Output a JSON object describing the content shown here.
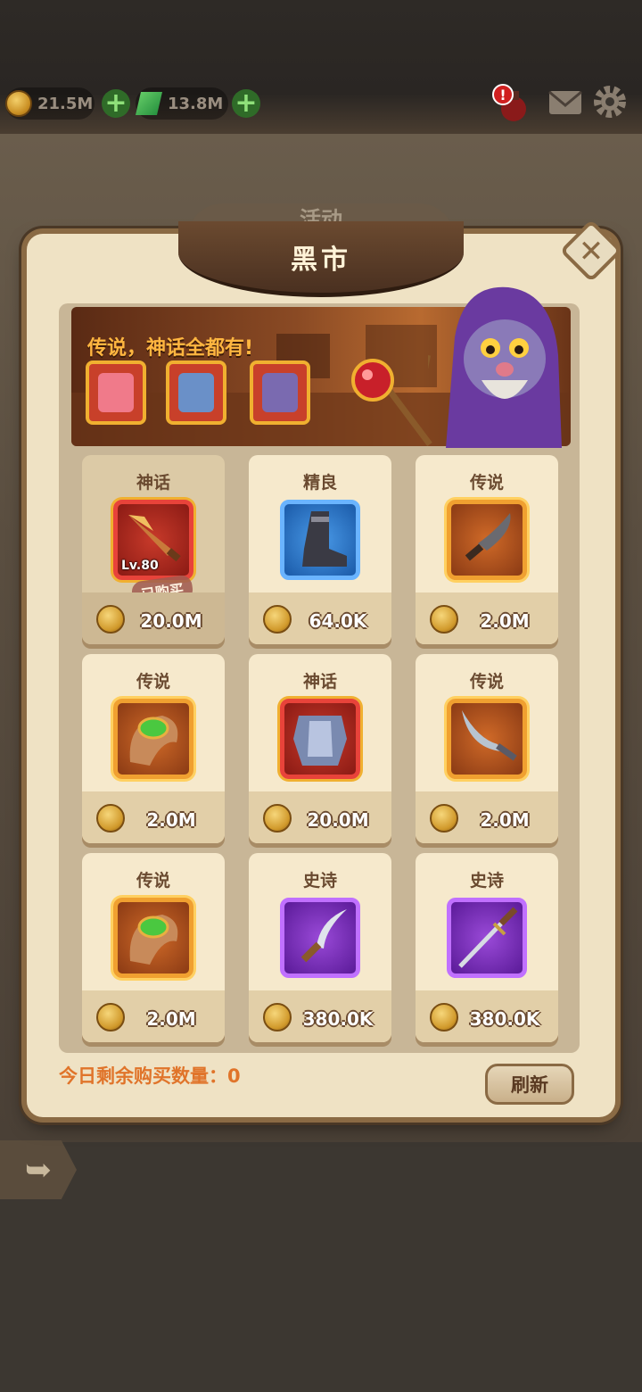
{
  "resources": {
    "gold": "21.5M",
    "gems": "13.8M"
  },
  "behind_title": "活动",
  "window": {
    "title": "黑市"
  },
  "banner": {
    "slogan": "传说，神话全都有!"
  },
  "items": [
    {
      "rarity": "神话",
      "price": "20.0M",
      "level": "Lv.80",
      "status": "已购买",
      "icon": "spear-tip-icon",
      "frame": "myth"
    },
    {
      "rarity": "精良",
      "price": "64.0K",
      "icon": "boot-icon",
      "frame": "good"
    },
    {
      "rarity": "传说",
      "price": "2.0M",
      "icon": "serrated-dagger-icon",
      "frame": "leg"
    },
    {
      "rarity": "传说",
      "price": "2.0M",
      "icon": "green-gem-horn-icon",
      "frame": "leg"
    },
    {
      "rarity": "神话",
      "price": "20.0M",
      "icon": "armor-icon",
      "frame": "myth"
    },
    {
      "rarity": "传说",
      "price": "2.0M",
      "icon": "curved-blade-icon",
      "frame": "leg"
    },
    {
      "rarity": "传说",
      "price": "2.0M",
      "icon": "green-gem-horn-icon",
      "frame": "leg"
    },
    {
      "rarity": "史诗",
      "price": "380.0K",
      "icon": "hook-blade-icon",
      "frame": "epic"
    },
    {
      "rarity": "史诗",
      "price": "380.0K",
      "icon": "stiletto-icon",
      "frame": "epic"
    }
  ],
  "footer": {
    "remaining_label": "今日剩余购买数量：0",
    "refresh_label": "刷新"
  },
  "colors": {
    "myth": "#e8433a",
    "legend": "#f0a030",
    "good": "#4a9ae8",
    "epic": "#9a4ad8",
    "footer_text": "#e0742a"
  }
}
